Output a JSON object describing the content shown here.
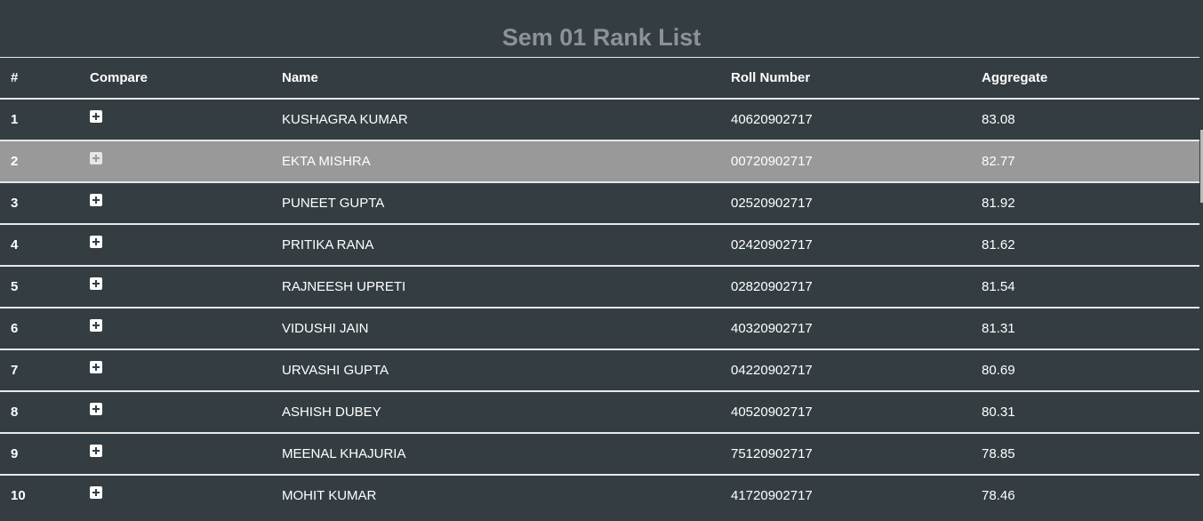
{
  "page": {
    "title": "Sem 01 Rank List"
  },
  "table": {
    "headers": [
      "#",
      "Compare",
      "Name",
      "Roll Number",
      "Aggregate"
    ],
    "rows": [
      {
        "rank": "1",
        "name": "KUSHAGRA KUMAR",
        "roll": "40620902717",
        "aggregate": "83.08"
      },
      {
        "rank": "2",
        "name": "EKTA MISHRA",
        "roll": "00720902717",
        "aggregate": "82.77"
      },
      {
        "rank": "3",
        "name": "PUNEET GUPTA",
        "roll": "02520902717",
        "aggregate": "81.92"
      },
      {
        "rank": "4",
        "name": "PRITIKA RANA",
        "roll": "02420902717",
        "aggregate": "81.62"
      },
      {
        "rank": "5",
        "name": "RAJNEESH UPRETI",
        "roll": "02820902717",
        "aggregate": "81.54"
      },
      {
        "rank": "6",
        "name": "VIDUSHI JAIN",
        "roll": "40320902717",
        "aggregate": "81.31"
      },
      {
        "rank": "7",
        "name": "URVASHI GUPTA",
        "roll": "04220902717",
        "aggregate": "80.69"
      },
      {
        "rank": "8",
        "name": "ASHISH DUBEY",
        "roll": "40520902717",
        "aggregate": "80.31"
      },
      {
        "rank": "9",
        "name": "MEENAL KHAJURIA",
        "roll": "75120902717",
        "aggregate": "78.85"
      },
      {
        "rank": "10",
        "name": "MOHIT KUMAR",
        "roll": "41720902717",
        "aggregate": "78.46"
      }
    ],
    "highlighted_row_rank": "2",
    "compare_icon": "plus-square-icon"
  },
  "colors": {
    "background": "#343e42",
    "title": "#8c9396",
    "highlight_row": "#999999",
    "divider": "#e8e8e8",
    "text": "#ffffff"
  }
}
